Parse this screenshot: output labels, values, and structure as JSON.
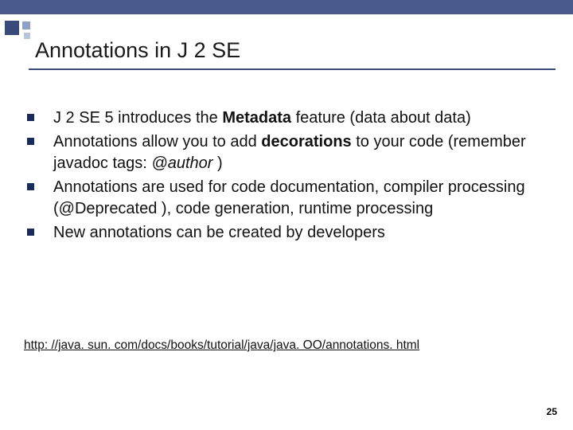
{
  "title": "Annotations in J 2 SE",
  "bullets": [
    {
      "pre": "J 2 SE 5 introduces the ",
      "bold": "Metadata",
      "post": " feature (data about data)"
    },
    {
      "pre": "Annotations allow you to add ",
      "bold": "decorations",
      "post": " to your code (remember javadoc tags: ",
      "em": "@author",
      "post2": " )"
    },
    {
      "pre": "Annotations are used for code documentation, compiler processing (@Deprecated ), code generation, runtime processing"
    },
    {
      "pre": "New annotations can be created by developers"
    }
  ],
  "link": "http: //java. sun. com/docs/books/tutorial/java/java. OO/annotations. html",
  "page_number": "25"
}
